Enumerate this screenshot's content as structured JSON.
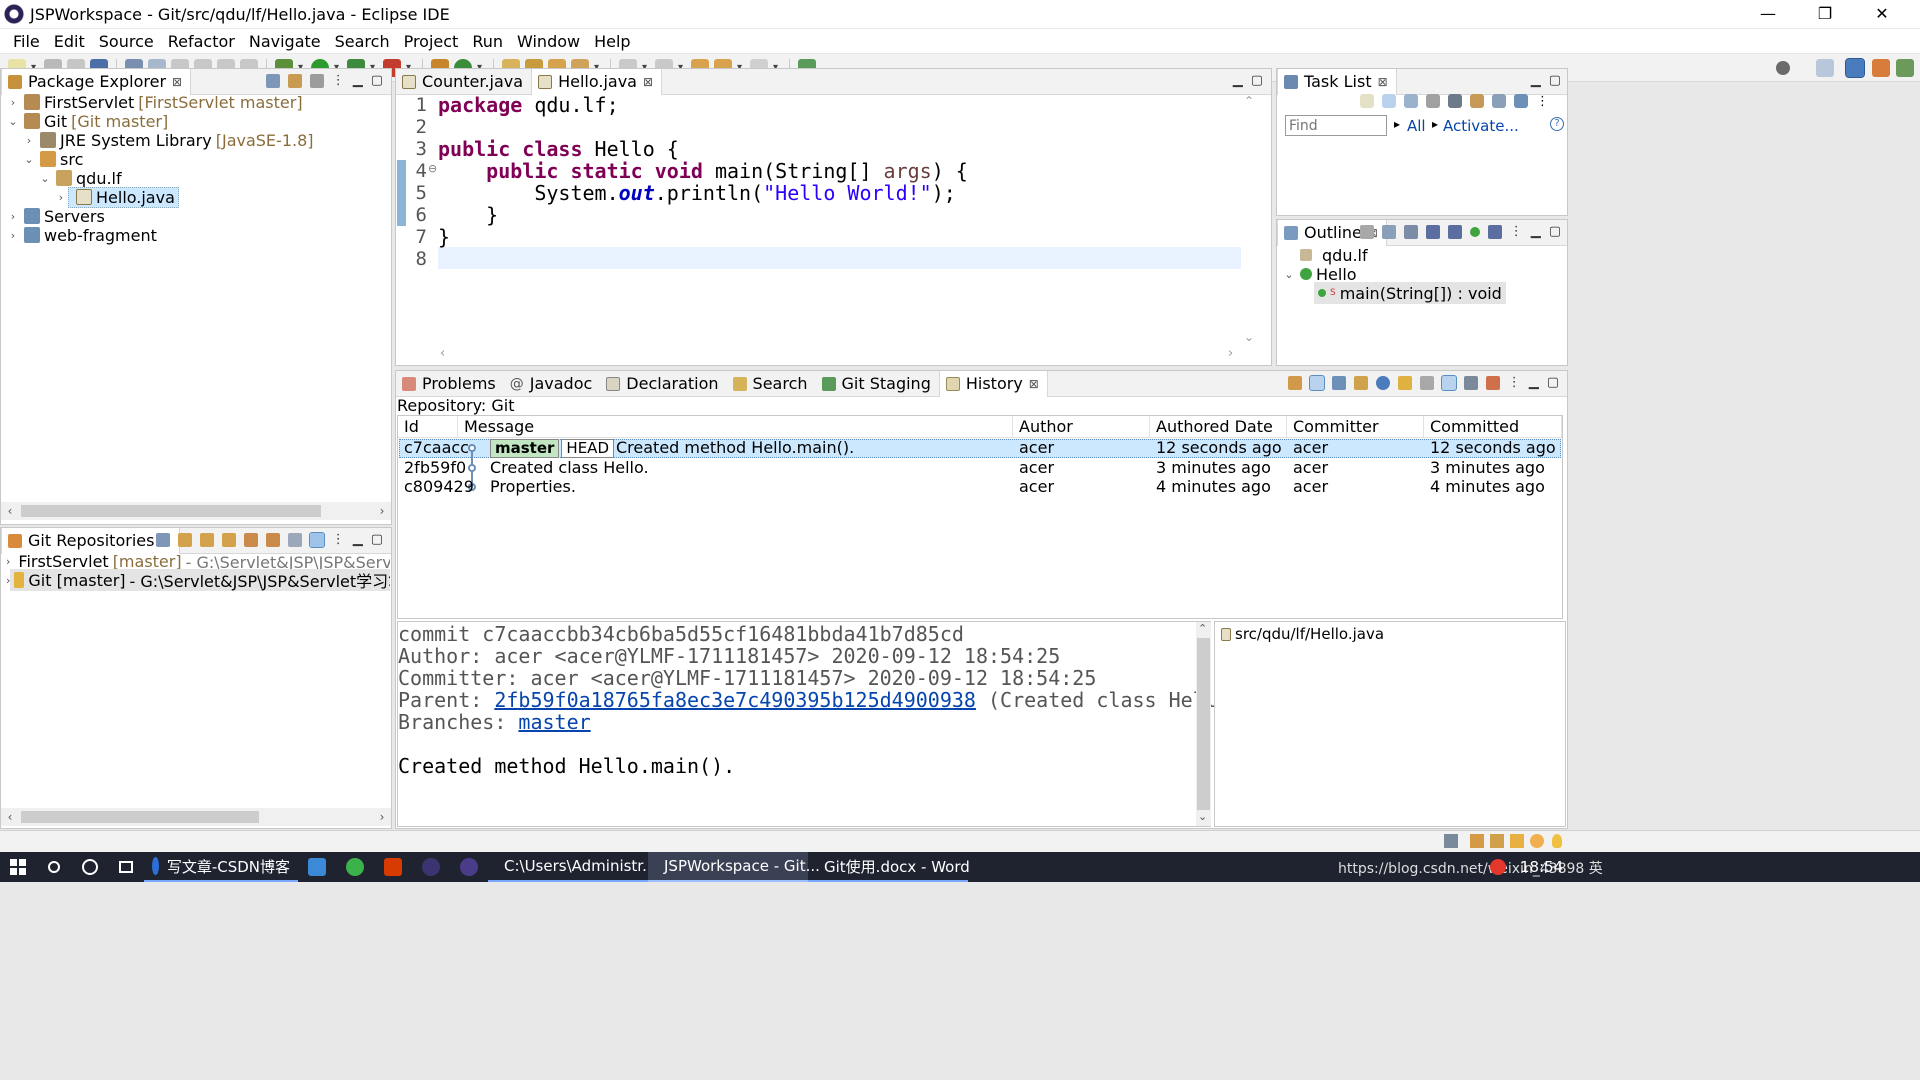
{
  "window": {
    "title": "JSPWorkspace - Git/src/qdu/lf/Hello.java - Eclipse IDE",
    "minimize": "—",
    "restore": "❐",
    "close": "✕"
  },
  "menu": [
    "File",
    "Edit",
    "Source",
    "Refactor",
    "Navigate",
    "Search",
    "Project",
    "Run",
    "Window",
    "Help"
  ],
  "package_explorer": {
    "title": "Package Explorer",
    "items": [
      {
        "label": "FirstServlet",
        "decoration": "[FirstServlet master]"
      },
      {
        "label": "Git",
        "decoration": "[Git master]"
      },
      {
        "label": "JRE System Library",
        "decoration": "[JavaSE-1.8]"
      },
      {
        "label": "src",
        "decoration": ""
      },
      {
        "label": "qdu.lf",
        "decoration": ""
      },
      {
        "label": "Hello.java",
        "decoration": ""
      },
      {
        "label": "Servers",
        "decoration": ""
      },
      {
        "label": "web-fragment",
        "decoration": ""
      }
    ]
  },
  "git_repositories": {
    "title": "Git Repositories",
    "items": [
      {
        "label": "FirstServlet",
        "decoration": "[master]",
        "path": "- G:\\Servlet&JSP\\JSP&Servlet学习笔记\\"
      },
      {
        "label": "Git [master]",
        "decoration": "",
        "path": "- G:\\Servlet&JSP\\JSP&Servlet学习笔记\\JSPWork"
      }
    ]
  },
  "editor": {
    "tabs": [
      "Counter.java",
      "Hello.java"
    ],
    "line_numbers": [
      "1",
      "2",
      "3",
      "4",
      "5",
      "6",
      "7",
      "8"
    ],
    "fold_marker": "⊖"
  },
  "task_list": {
    "title": "Task List",
    "find_placeholder": "Find",
    "all": "All",
    "activate": "Activate...",
    "help": "?"
  },
  "outline": {
    "title": "Outline",
    "items": [
      {
        "label": "qdu.lf"
      },
      {
        "label": "Hello"
      },
      {
        "label": "main(String[]) : void"
      }
    ]
  },
  "bottom_tabs": [
    "Problems",
    "Javadoc",
    "Declaration",
    "Search",
    "Git Staging",
    "History"
  ],
  "history": {
    "repository": "Repository: Git",
    "columns": [
      "Id",
      "Message",
      "Author",
      "Authored Date",
      "Committer",
      "Committed Date"
    ],
    "rows": [
      {
        "id": "c7caacc",
        "tag1": "master",
        "tag2": "HEAD",
        "message": "Created method Hello.main().",
        "author": "acer",
        "authored": "12 seconds ago",
        "committer": "acer",
        "committed": "12 seconds ago"
      },
      {
        "id": "2fb59f0",
        "tag1": "",
        "tag2": "",
        "message": "Created class Hello.",
        "author": "acer",
        "authored": "3 minutes ago",
        "committer": "acer",
        "committed": "3 minutes ago"
      },
      {
        "id": "c809429",
        "tag1": "",
        "tag2": "",
        "message": "Properties.",
        "author": "acer",
        "authored": "4 minutes ago",
        "committer": "acer",
        "committed": "4 minutes ago"
      }
    ],
    "detail": {
      "commit": "commit c7caaccbb34cb6ba5d55cf16481bbda41b7d85cd",
      "author": "Author: acer <acer@YLMF-1711181457> 2020-09-12 18:54:25",
      "committer": "Committer: acer <acer@YLMF-1711181457> 2020-09-12 18:54:25",
      "parent_label": "Parent: ",
      "parent_hash": "2fb59f0a18765fa8ec3e7c490395b125d4900938",
      "parent_note": " (Created class Hello.)",
      "branches_label": "Branches: ",
      "branch": "master",
      "message": "Created method Hello.main()."
    },
    "file": "src/qdu/lf/Hello.java"
  },
  "taskbar": {
    "items": [
      {
        "label": "写文章-CSDN博客"
      },
      {
        "label": "C:\\Users\\Administr..."
      },
      {
        "label": "JSPWorkspace - Git..."
      },
      {
        "label": "Git使用.docx - Word"
      }
    ],
    "tray": "https://blog.csdn.net/weixin_43898 英",
    "clock": "18:54"
  }
}
